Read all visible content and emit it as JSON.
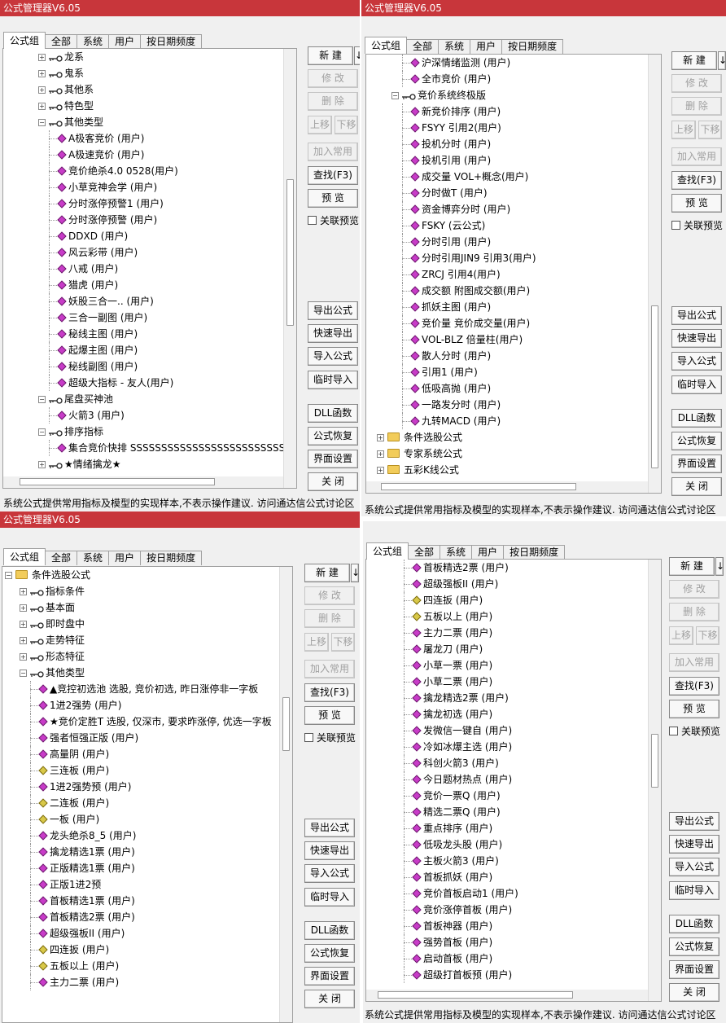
{
  "common": {
    "title": "公式管理器V6.05",
    "close_glyph": "×",
    "tabs": [
      "公式组",
      "全部",
      "系统",
      "用户",
      "按日期频度"
    ],
    "buttons": {
      "new": "新 建",
      "new_arrow": "↓",
      "modify": "修 改",
      "delete": "删 除",
      "move_up": "上移",
      "move_down": "下移",
      "add_common": "加入常用",
      "find": "查找(F3)",
      "preview": "预 览",
      "link_preview": "关联预览",
      "export": "导出公式",
      "quick_export": "快速导出",
      "import": "导入公式",
      "temp_import": "临时导入",
      "dll": "DLL函数",
      "restore": "公式恢复",
      "ui_settings": "界面设置",
      "close": "关 闭"
    },
    "footer": "系统公式提供常用指标及模型的实现样本,不表示操作建议.   访问通达信公式讨论区",
    "icons": {
      "expand": "plus-box-icon",
      "collapse": "minus-box-icon",
      "group": "key-icon",
      "formula": "diamond-icon",
      "folder": "folder-icon"
    },
    "colors": {
      "titlebar": "#c8363b",
      "diamond": "#c83cc8",
      "diamond_yellow": "#d8c848",
      "folder": "#f2cc5a"
    }
  },
  "panels": [
    {
      "rows": [
        {
          "level": 1,
          "icon": "key",
          "exp": "+",
          "text": "龙系"
        },
        {
          "level": 1,
          "icon": "key",
          "exp": "+",
          "text": "鬼系"
        },
        {
          "level": 1,
          "icon": "key",
          "exp": "+",
          "text": "其他系"
        },
        {
          "level": 1,
          "icon": "key",
          "exp": "+",
          "text": "特色型"
        },
        {
          "level": 1,
          "icon": "key",
          "exp": "-",
          "text": "其他类型"
        },
        {
          "level": 2,
          "icon": "diamond",
          "text": "A极客竞价 (用户)"
        },
        {
          "level": 2,
          "icon": "diamond",
          "text": "A极速竞价 (用户)"
        },
        {
          "level": 2,
          "icon": "diamond",
          "text": "竞价绝杀4.0  0528(用户)"
        },
        {
          "level": 2,
          "icon": "diamond",
          "text": "小草竞神会学 (用户)"
        },
        {
          "level": 2,
          "icon": "diamond",
          "text": "分时涨停预警1 (用户)"
        },
        {
          "level": 2,
          "icon": "diamond",
          "text": "分时涨停预警 (用户)"
        },
        {
          "level": 2,
          "icon": "diamond",
          "text": "DDXD (用户)"
        },
        {
          "level": 2,
          "icon": "diamond",
          "text": "风云彩带 (用户)"
        },
        {
          "level": 2,
          "icon": "diamond",
          "text": "八戒 (用户)"
        },
        {
          "level": 2,
          "icon": "diamond",
          "text": "猎虎 (用户)"
        },
        {
          "level": 2,
          "icon": "diamond",
          "text": "妖股三合一.. (用户)"
        },
        {
          "level": 2,
          "icon": "diamond",
          "text": "三合一副图 (用户)"
        },
        {
          "level": 2,
          "icon": "diamond",
          "text": "秘线主图 (用户)"
        },
        {
          "level": 2,
          "icon": "diamond",
          "text": "起爆主图 (用户)"
        },
        {
          "level": 2,
          "icon": "diamond",
          "text": "秘线副图 (用户)"
        },
        {
          "level": 2,
          "icon": "diamond",
          "text": "超级大指标  - 友人(用户)"
        },
        {
          "level": 1,
          "icon": "key",
          "exp": "-",
          "text": "尾盘买神池"
        },
        {
          "level": 2,
          "icon": "diamond",
          "text": "火箭3 (用户)"
        },
        {
          "level": 1,
          "icon": "key",
          "exp": "-",
          "text": "排序指标"
        },
        {
          "level": 2,
          "icon": "diamond",
          "text": "集合竞价快排  SSSSSSSSSSSSSSSSSSSSSSSSSSSSS"
        },
        {
          "level": 1,
          "icon": "key",
          "exp": "+",
          "text": "★情绪擒龙★"
        }
      ]
    },
    {
      "rows": [
        {
          "level": 2,
          "icon": "diamond",
          "text": "沪深情绪监测 (用户)"
        },
        {
          "level": 2,
          "icon": "diamond",
          "text": "全市竞价 (用户)"
        },
        {
          "level": 1,
          "icon": "key",
          "exp": "-",
          "text": "竞价系统终极版"
        },
        {
          "level": 2,
          "icon": "diamond",
          "text": "新竞价排序 (用户)"
        },
        {
          "level": 2,
          "icon": "diamond",
          "text": "FSYY  引用2(用户)"
        },
        {
          "level": 2,
          "icon": "diamond",
          "text": "投机分时 (用户)"
        },
        {
          "level": 2,
          "icon": "diamond",
          "text": "投机引用 (用户)"
        },
        {
          "level": 2,
          "icon": "diamond",
          "text": "成交量  VOL+概念(用户)"
        },
        {
          "level": 2,
          "icon": "diamond",
          "text": "分时做T (用户)"
        },
        {
          "level": 2,
          "icon": "diamond",
          "text": "资金博弈分时 (用户)"
        },
        {
          "level": 2,
          "icon": "diamond",
          "text": "FSKY (云公式)"
        },
        {
          "level": 2,
          "icon": "diamond",
          "text": "分时引用 (用户)"
        },
        {
          "level": 2,
          "icon": "diamond",
          "text": "分时引用JIN9  引用3(用户)"
        },
        {
          "level": 2,
          "icon": "diamond",
          "text": "ZRCJ  引用4(用户)"
        },
        {
          "level": 2,
          "icon": "diamond",
          "text": "成交额  附图成交额(用户)"
        },
        {
          "level": 2,
          "icon": "diamond",
          "text": "抓妖主图 (用户)"
        },
        {
          "level": 2,
          "icon": "diamond",
          "text": "竞价量  竞价成交量(用户)"
        },
        {
          "level": 2,
          "icon": "diamond",
          "text": "VOL-BLZ  倍量柱(用户)"
        },
        {
          "level": 2,
          "icon": "diamond",
          "text": "散人分时 (用户)"
        },
        {
          "level": 2,
          "icon": "diamond",
          "text": "引用1 (用户)"
        },
        {
          "level": 2,
          "icon": "diamond",
          "text": "低吸高抛 (用户)"
        },
        {
          "level": 2,
          "icon": "diamond",
          "text": "一路发分时 (用户)"
        },
        {
          "level": 2,
          "icon": "diamond",
          "text": "九转MACD (用户)"
        },
        {
          "level": 0,
          "icon": "folder",
          "exp": "+",
          "text": "条件选股公式"
        },
        {
          "level": 0,
          "icon": "folder",
          "exp": "+",
          "text": "专家系统公式"
        },
        {
          "level": 0,
          "icon": "folder",
          "exp": "+",
          "text": "五彩K线公式"
        }
      ]
    },
    {
      "rows": [
        {
          "level": 0,
          "icon": "folder",
          "exp": "-",
          "text": "条件选股公式"
        },
        {
          "level": 1,
          "icon": "key",
          "exp": "+",
          "text": "指标条件"
        },
        {
          "level": 1,
          "icon": "key",
          "exp": "+",
          "text": "基本面"
        },
        {
          "level": 1,
          "icon": "key",
          "exp": "+",
          "text": "即时盘中"
        },
        {
          "level": 1,
          "icon": "key",
          "exp": "+",
          "text": "走势特征"
        },
        {
          "level": 1,
          "icon": "key",
          "exp": "+",
          "text": "形态特征"
        },
        {
          "level": 1,
          "icon": "key",
          "exp": "-",
          "text": "其他类型"
        },
        {
          "level": 2,
          "icon": "diamond",
          "text": "▲竞控初选池  选股, 竞价初选, 昨日涨停非一字板"
        },
        {
          "level": 2,
          "icon": "diamond",
          "text": "1进2强势 (用户)"
        },
        {
          "level": 2,
          "icon": "diamond",
          "text": "★竞价定胜T  选股, 仅深市, 要求昨涨停, 优选一字板"
        },
        {
          "level": 2,
          "icon": "diamond",
          "text": "强者恒强正版 (用户)"
        },
        {
          "level": 2,
          "icon": "diamond",
          "text": "高量阴 (用户)"
        },
        {
          "level": 2,
          "icon": "diamond-y",
          "text": "三连板 (用户)"
        },
        {
          "level": 2,
          "icon": "diamond",
          "text": "1进2强势预 (用户)"
        },
        {
          "level": 2,
          "icon": "diamond-y",
          "text": "二连板 (用户)"
        },
        {
          "level": 2,
          "icon": "diamond-y",
          "text": "一板 (用户)"
        },
        {
          "level": 2,
          "icon": "diamond",
          "text": "龙头绝杀8_5 (用户)"
        },
        {
          "level": 2,
          "icon": "diamond",
          "text": "擒龙精选1票 (用户)"
        },
        {
          "level": 2,
          "icon": "diamond",
          "text": "正版精选1票 (用户)"
        },
        {
          "level": 2,
          "icon": "diamond",
          "text": "正版1进2预"
        },
        {
          "level": 2,
          "icon": "diamond",
          "text": "首板精选1票 (用户)"
        },
        {
          "level": 2,
          "icon": "diamond",
          "text": "首板精选2票 (用户)"
        },
        {
          "level": 2,
          "icon": "diamond",
          "text": "超级强板II (用户)"
        },
        {
          "level": 2,
          "icon": "diamond-y",
          "text": "四连扳 (用户)"
        },
        {
          "level": 2,
          "icon": "diamond-y",
          "text": "五板以上 (用户)"
        },
        {
          "level": 2,
          "icon": "diamond",
          "text": "主力二票 (用户)"
        }
      ]
    },
    {
      "rows": [
        {
          "level": 2,
          "icon": "diamond",
          "text": "首板精选2票 (用户)"
        },
        {
          "level": 2,
          "icon": "diamond",
          "text": "超级强板II (用户)"
        },
        {
          "level": 2,
          "icon": "diamond-y",
          "text": "四连扳 (用户)"
        },
        {
          "level": 2,
          "icon": "diamond-y",
          "text": "五板以上 (用户)"
        },
        {
          "level": 2,
          "icon": "diamond",
          "text": "主力二票 (用户)"
        },
        {
          "level": 2,
          "icon": "diamond",
          "text": "屠龙刀 (用户)"
        },
        {
          "level": 2,
          "icon": "diamond",
          "text": "小草一票 (用户)"
        },
        {
          "level": 2,
          "icon": "diamond",
          "text": "小草二票 (用户)"
        },
        {
          "level": 2,
          "icon": "diamond",
          "text": "擒龙精选2票 (用户)"
        },
        {
          "level": 2,
          "icon": "diamond",
          "text": "擒龙初选 (用户)"
        },
        {
          "level": 2,
          "icon": "diamond",
          "text": "发微信一键自 (用户)"
        },
        {
          "level": 2,
          "icon": "diamond",
          "text": "冷如冰爆主选 (用户)"
        },
        {
          "level": 2,
          "icon": "diamond",
          "text": "科创火箭3 (用户)"
        },
        {
          "level": 2,
          "icon": "diamond",
          "text": "今日题材热点 (用户)"
        },
        {
          "level": 2,
          "icon": "diamond",
          "text": "竞价一票Q (用户)"
        },
        {
          "level": 2,
          "icon": "diamond",
          "text": "精选二票Q (用户)"
        },
        {
          "level": 2,
          "icon": "diamond",
          "text": "重点排序 (用户)"
        },
        {
          "level": 2,
          "icon": "diamond",
          "text": "低吸龙头股 (用户)"
        },
        {
          "level": 2,
          "icon": "diamond",
          "text": "主板火箭3 (用户)"
        },
        {
          "level": 2,
          "icon": "diamond",
          "text": "首板抓妖 (用户)"
        },
        {
          "level": 2,
          "icon": "diamond",
          "text": "竞价首板启动1 (用户)"
        },
        {
          "level": 2,
          "icon": "diamond",
          "text": "竞价涨停首板 (用户)"
        },
        {
          "level": 2,
          "icon": "diamond",
          "text": "首板神器 (用户)"
        },
        {
          "level": 2,
          "icon": "diamond",
          "text": "强势首板 (用户)"
        },
        {
          "level": 2,
          "icon": "diamond",
          "text": "启动首板 (用户)"
        },
        {
          "level": 2,
          "icon": "diamond",
          "text": "超级打首板预 (用户)"
        }
      ]
    }
  ]
}
